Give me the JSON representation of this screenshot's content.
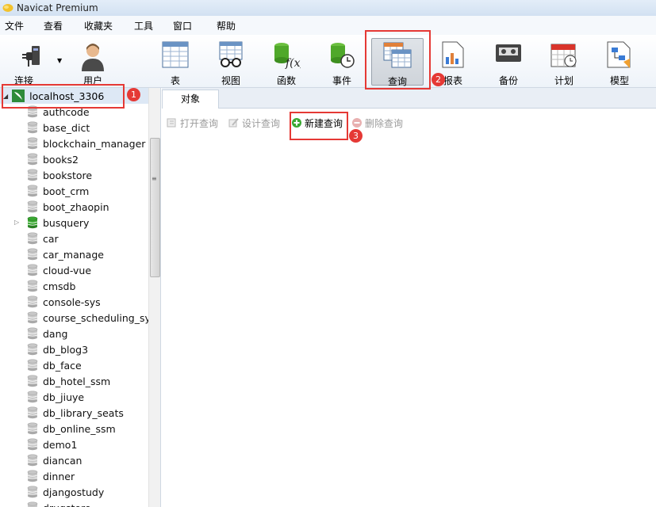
{
  "window": {
    "title": "Navicat Premium"
  },
  "menu": [
    "文件",
    "查看",
    "收藏夹",
    "工具",
    "窗口",
    "帮助"
  ],
  "toolbar": {
    "connect_label": "连接",
    "user_label": "用户",
    "table_label": "表",
    "view_label": "视图",
    "function_label": "函数",
    "event_label": "事件",
    "query_label": "查询",
    "report_label": "报表",
    "backup_label": "备份",
    "schedule_label": "计划",
    "model_label": "模型"
  },
  "sidebar": {
    "connection": "localhost_3306",
    "databases": [
      "authcode",
      "base_dict",
      "blockchain_manager",
      "books2",
      "bookstore",
      "boot_crm",
      "boot_zhaopin",
      "busquery",
      "car",
      "car_manage",
      "cloud-vue",
      "cmsdb",
      "console-sys",
      "course_scheduling_syst",
      "dang",
      "db_blog3",
      "db_face",
      "db_hotel_ssm",
      "db_jiuye",
      "db_library_seats",
      "db_online_ssm",
      "demo1",
      "diancan",
      "dinner",
      "djangostudy",
      "drugstore"
    ],
    "open_db": "busquery"
  },
  "main": {
    "tab_label": "对象",
    "open_query": "打开查询",
    "design_query": "设计查询",
    "new_query": "新建查询",
    "delete_query": "删除查询"
  },
  "annotations": {
    "step1": "1",
    "step2": "2",
    "step3": "3"
  },
  "colors": {
    "annotation_red": "#e53935",
    "db_open_green": "#3aa832",
    "db_grey": "#c8c8c8"
  }
}
